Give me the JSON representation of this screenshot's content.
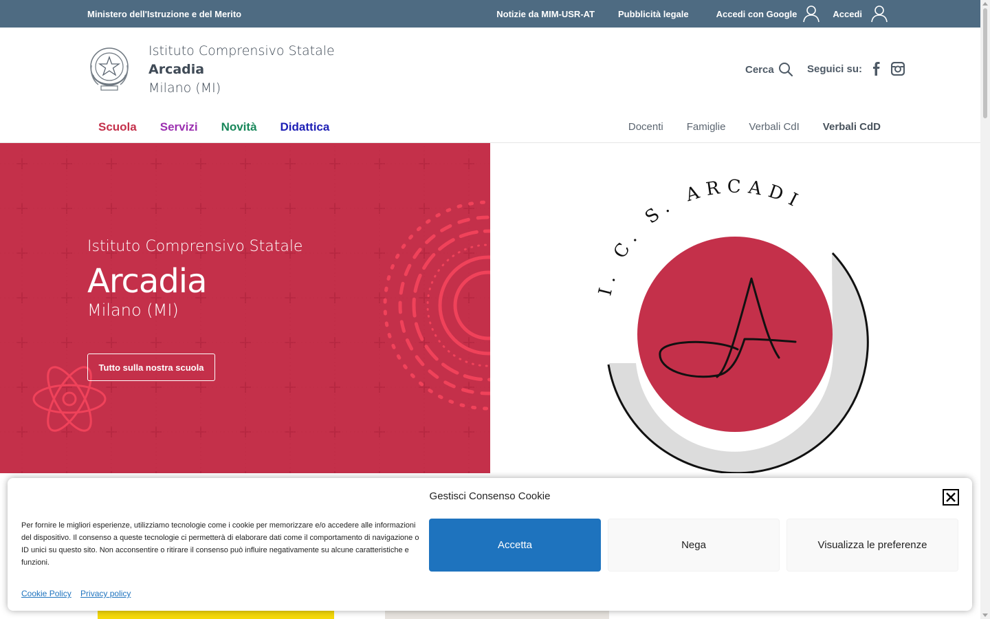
{
  "topbar": {
    "ministry": "Ministero dell'Istruzione e del Merito",
    "links": {
      "news": "Notizie da MIM-USR-AT",
      "legal": "Pubblicità legale",
      "google_login": "Accedi con Google",
      "login": "Accedi"
    }
  },
  "header": {
    "school_line1": "Istituto Comprensivo Statale",
    "school_line2": "Arcadia",
    "school_line3": "Milano (MI)",
    "search_label": "Cerca",
    "social_label": "Seguici su:"
  },
  "mainnav": {
    "items": [
      {
        "label": "Scuola",
        "color": "#c4304a"
      },
      {
        "label": "Servizi",
        "color": "#9b2fb0"
      },
      {
        "label": "Novità",
        "color": "#18875a"
      },
      {
        "label": "Didattica",
        "color": "#1d1fb5"
      }
    ]
  },
  "subnav": {
    "items": [
      "Docenti",
      "Famiglie",
      "Verbali CdI",
      "Verbali CdD"
    ]
  },
  "hero": {
    "subtitle": "Istituto Comprensivo Statale",
    "title": "Arcadia",
    "place": "Milano (MI)",
    "button": "Tutto sulla nostra scuola",
    "logo_text": "I. C. S. ARCADIA"
  },
  "cookie": {
    "title": "Gestisci Consenso Cookie",
    "message": "Per fornire le migliori esperienze, utilizziamo tecnologie come i cookie per memorizzare e/o accedere alle informazioni del dispositivo. Il consenso a queste tecnologie ci permetterà di elaborare dati come il comportamento di navigazione o ID unici su questo sito. Non acconsentire o ritirare il consenso può influire negativamente su alcune caratteristiche e funzioni.",
    "accept": "Accetta",
    "deny": "Nega",
    "preferences": "Visualizza le preferenze",
    "cookie_policy": "Cookie Policy",
    "privacy_policy": "Privacy policy"
  },
  "colors": {
    "topbar": "#4e6b82",
    "brand_red": "#c4304a",
    "accent_blue": "#1e73be",
    "a11y_blue": "#1e5da8"
  }
}
